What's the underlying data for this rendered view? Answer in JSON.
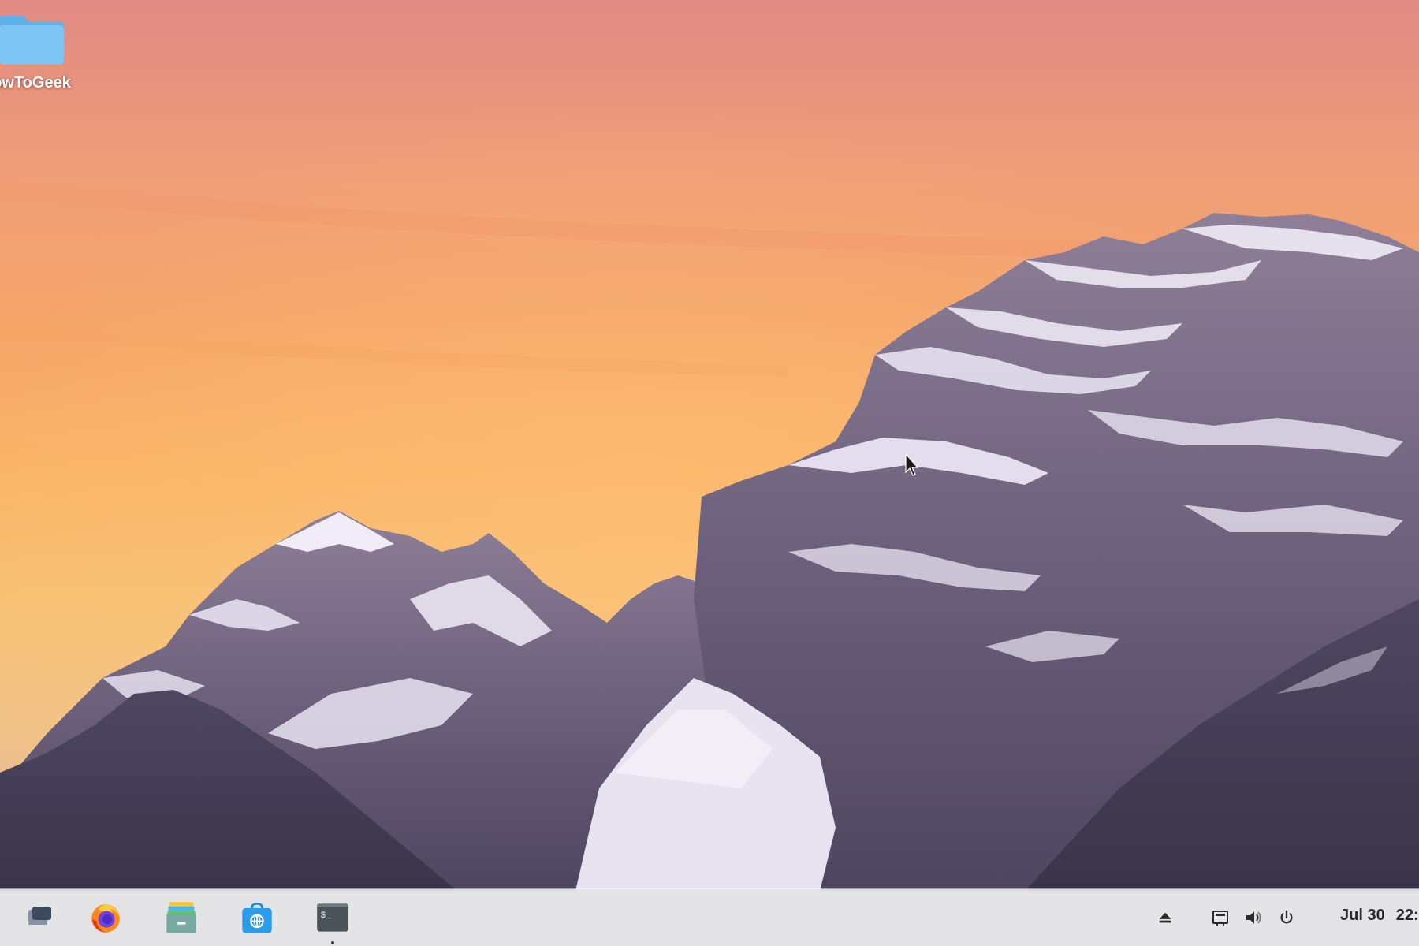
{
  "desktop": {
    "icons": [
      {
        "label": "owToGeek",
        "icon": "folder-icon"
      }
    ]
  },
  "taskbar": {
    "apps": [
      {
        "name": "workspaces",
        "icon": "workspaces-icon"
      },
      {
        "name": "firefox",
        "icon": "firefox-icon"
      },
      {
        "name": "files",
        "icon": "files-icon"
      },
      {
        "name": "software-store",
        "icon": "software-store-icon"
      },
      {
        "name": "terminal",
        "icon": "terminal-icon",
        "terminal_glyph": "$_"
      }
    ],
    "tray": [
      {
        "name": "eject",
        "icon": "eject-icon"
      },
      {
        "name": "network",
        "icon": "network-icon"
      },
      {
        "name": "volume",
        "icon": "volume-icon"
      },
      {
        "name": "power",
        "icon": "power-icon"
      }
    ],
    "clock": {
      "date": "Jul 30",
      "time": "22:"
    }
  },
  "colors": {
    "sky_top": "#e08a84",
    "sky_mid": "#f9b467",
    "taskbar_bg": "#e4e6ec",
    "folder_blue": "#6ebcf0"
  }
}
